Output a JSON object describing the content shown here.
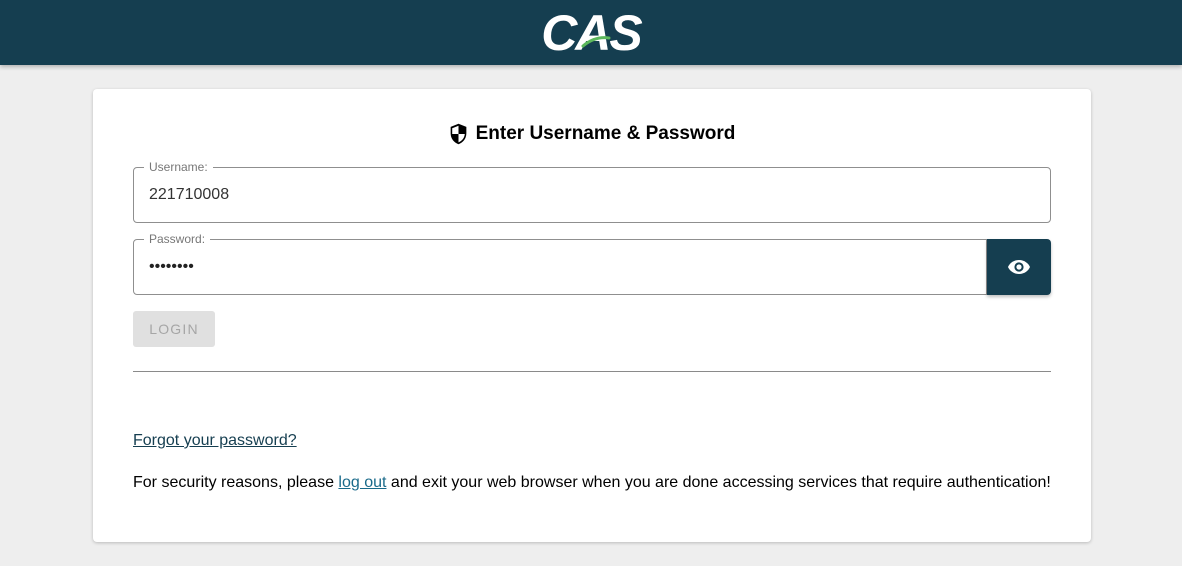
{
  "header": {
    "logo_text": "CAS",
    "bar_color": "#153e50"
  },
  "login": {
    "heading": "Enter Username & Password",
    "heading_icon": "shield-icon",
    "username": {
      "label": "Username:",
      "value": "221710008"
    },
    "password": {
      "label": "Password:",
      "value": "••••••••"
    },
    "toggle_icon": "eye-icon",
    "login_label": "LOGIN",
    "forgot_link": "Forgot your password?",
    "security_prefix": "For security reasons, please ",
    "logout_link": "log out",
    "security_suffix": " and exit your web browser when you are done accessing services that require authentication!"
  }
}
